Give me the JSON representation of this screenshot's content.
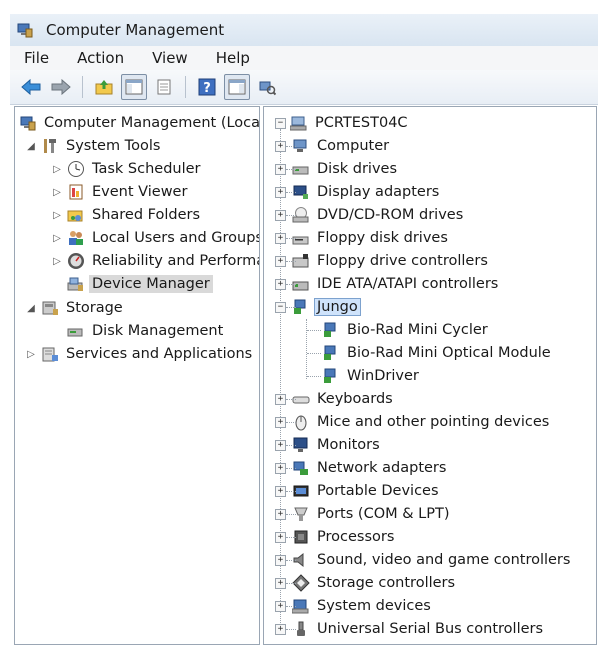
{
  "window": {
    "title": "Computer Management"
  },
  "menu": [
    "File",
    "Action",
    "View",
    "Help"
  ],
  "left_tree": {
    "root": "Computer Management (Local",
    "system_tools": "System Tools",
    "task_scheduler": "Task Scheduler",
    "event_viewer": "Event Viewer",
    "shared_folders": "Shared Folders",
    "local_users": "Local Users and Groups",
    "reliability": "Reliability and Performa",
    "device_manager": "Device Manager",
    "storage": "Storage",
    "disk_management": "Disk Management",
    "services": "Services and Applications"
  },
  "device_tree": {
    "root": "PCRTEST04C",
    "categories": [
      "Computer",
      "Disk drives",
      "Display adapters",
      "DVD/CD-ROM drives",
      "Floppy disk drives",
      "Floppy drive controllers",
      "IDE ATA/ATAPI controllers"
    ],
    "expanded": {
      "name": "Jungo",
      "children": [
        "Bio-Rad Mini Cycler",
        "Bio-Rad Mini Optical Module",
        "WinDriver"
      ]
    },
    "categories_after": [
      "Keyboards",
      "Mice and other pointing devices",
      "Monitors",
      "Network adapters",
      "Portable Devices",
      "Ports (COM & LPT)",
      "Processors",
      "Sound, video and game controllers",
      "Storage controllers",
      "System devices",
      "Universal Serial Bus controllers"
    ]
  },
  "colors": {
    "selection_bg": "#cfe3fb",
    "selection_border": "#7da2ce",
    "pane_border": "#9aa6b4"
  }
}
